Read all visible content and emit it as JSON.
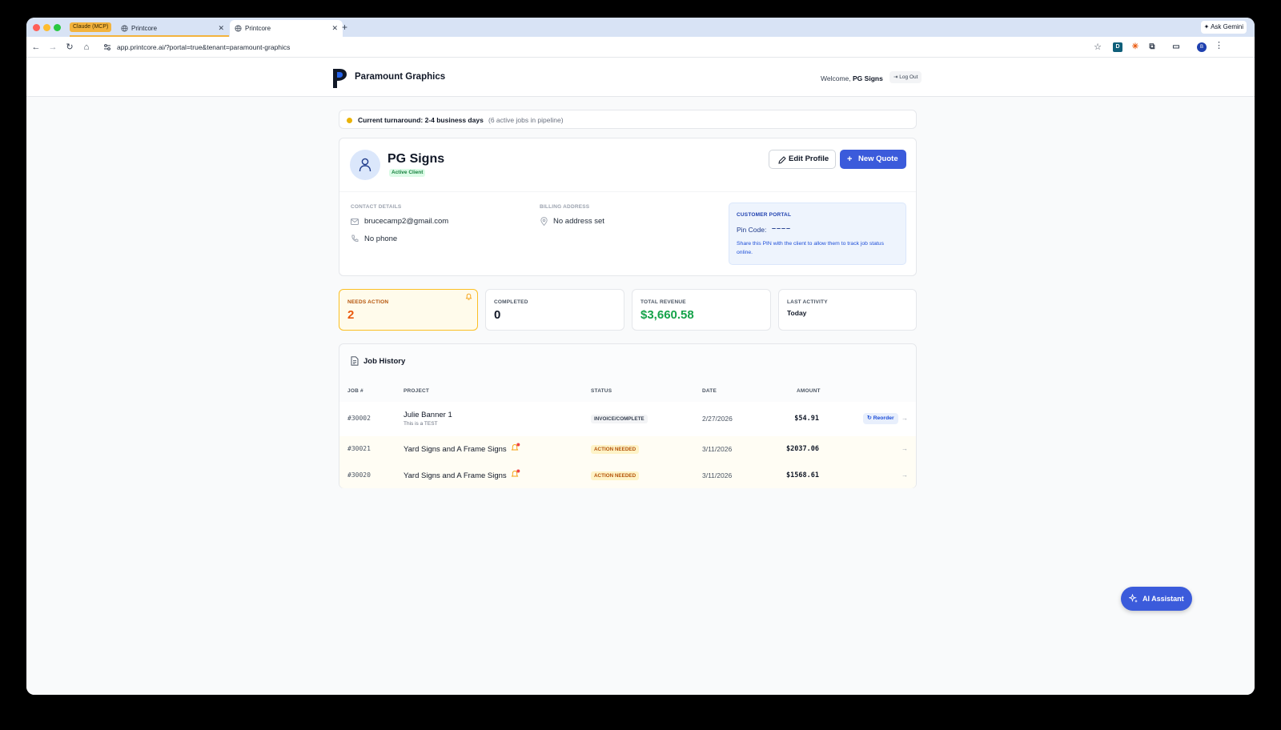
{
  "browser": {
    "tab_group_label": "Claude (MCP)",
    "tabs": [
      {
        "title": "Printcore"
      },
      {
        "title": "Printcore"
      }
    ],
    "new_tab": "+",
    "url": "app.printcore.ai/?portal=true&tenant=paramount-graphics",
    "ask_gemini": "Ask Gemini",
    "profile_initial": "B"
  },
  "header": {
    "brand": "Paramount Graphics",
    "welcome_prefix": "Welcome,",
    "welcome_name": "PG Signs",
    "logout_label": "Log Out"
  },
  "turnaround": {
    "main": "Current turnaround: 2-4 business days",
    "sub": "(6 active jobs in pipeline)"
  },
  "client": {
    "name": "PG Signs",
    "status": "Active Client",
    "edit_label": "Edit Profile",
    "new_quote_label": "New Quote",
    "contact_heading": "CONTACT DETAILS",
    "email": "brucecamp2@gmail.com",
    "phone": "No phone",
    "billing_heading": "BILLING ADDRESS",
    "address": "No address set"
  },
  "portal": {
    "heading": "CUSTOMER PORTAL",
    "pin_label": "Pin Code:",
    "pin_value": "––––",
    "note": "Share this PIN with the client to allow them to track job status online."
  },
  "stats": {
    "needs_action": {
      "label": "NEEDS ACTION",
      "value": "2"
    },
    "completed": {
      "label": "COMPLETED",
      "value": "0"
    },
    "revenue": {
      "label": "TOTAL REVENUE",
      "value": "$3,660.58"
    },
    "activity": {
      "label": "LAST ACTIVITY",
      "value": "Today"
    }
  },
  "jobs": {
    "title": "Job History",
    "columns": [
      "JOB #",
      "PROJECT",
      "STATUS",
      "DATE",
      "AMOUNT"
    ],
    "rows": [
      {
        "job": "#30002",
        "project": "Julie Banner 1",
        "note": "This is a TEST",
        "status": "INVOICE/COMPLETE",
        "date": "2/27/2026",
        "amount": "$54.91",
        "action": "Reorder"
      },
      {
        "job": "#30021",
        "project": "Yard Signs and A Frame Signs",
        "status": "ACTION NEEDED",
        "date": "3/11/2026",
        "amount": "$2037.06"
      },
      {
        "job": "#30020",
        "project": "Yard Signs and A Frame Signs",
        "status": "ACTION NEEDED",
        "date": "3/11/2026",
        "amount": "$1568.61"
      }
    ]
  },
  "assistant": {
    "label": "AI Assistant"
  },
  "colors": {
    "primary": "#3b5bdb",
    "revenue": "#16a34a",
    "needs_action": "#ea580c",
    "tab_group": "#f3b33d"
  }
}
